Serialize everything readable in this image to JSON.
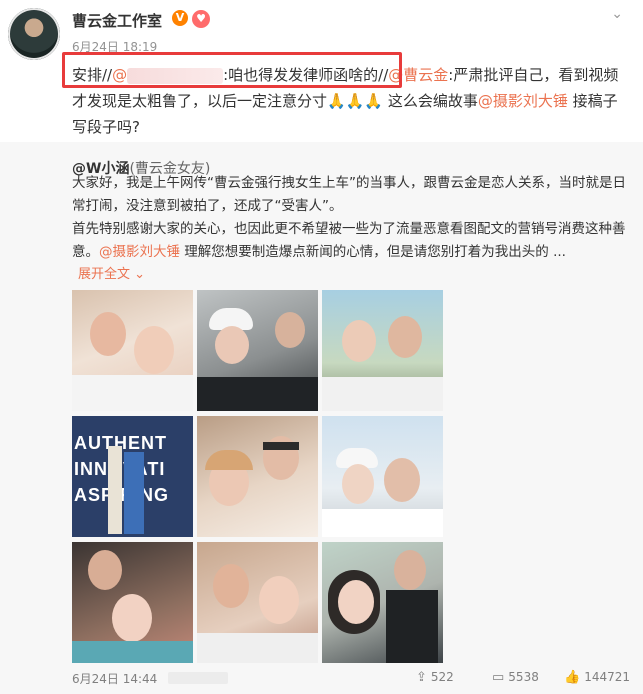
{
  "post": {
    "author": "曹云金工作室",
    "verified_badge": "V",
    "time": "6月24日 18:19",
    "text_parts": {
      "p1": "安排//",
      "p2": "@",
      "p3": ":咱也得发发律师函啥的//",
      "p4": "@曹云金",
      "p5": ":严肃批评自己，看到视频才发现是太粗鲁了，以后一定注意分寸",
      "p6": " 这么会编故事",
      "p7": "@摄影刘大锤",
      "p8": " 接稿子写段子吗?"
    },
    "clap_emoji": "🙏🙏🙏",
    "highlight_color": "#e83b3b"
  },
  "repost": {
    "author": "@W小涵",
    "author_note": "(曹云金女友)",
    "text": "大家好，我是上午网传“曹云金强行拽女生上车”的当事人，跟曹云金是恋人关系，当时就是日常打闹，没注意到被拍了，还成了“受害人”。",
    "text2_a": "首先特别感谢大家的关心，也因此更不希望被一些为了流量恶意看图配文的营销号消费这种善意。",
    "text2_at": "@摄影刘大锤",
    "text2_b": " 理解您想要制造爆点新闻的心情，但是请您别打着为我出头的 ...",
    "expand_label": "展开全文",
    "expand_icon": "chevron-down-icon",
    "photo_wall_text": [
      "AUTHENT",
      "INNOVATI",
      "ASPIRING"
    ],
    "date": "6月24日 14:44",
    "reposts": "522",
    "comments": "5538",
    "likes": "144721"
  },
  "colors": {
    "accent": "#eb7350",
    "vbadge": "#ff8200",
    "repost_bg": "#f7f7f7"
  }
}
